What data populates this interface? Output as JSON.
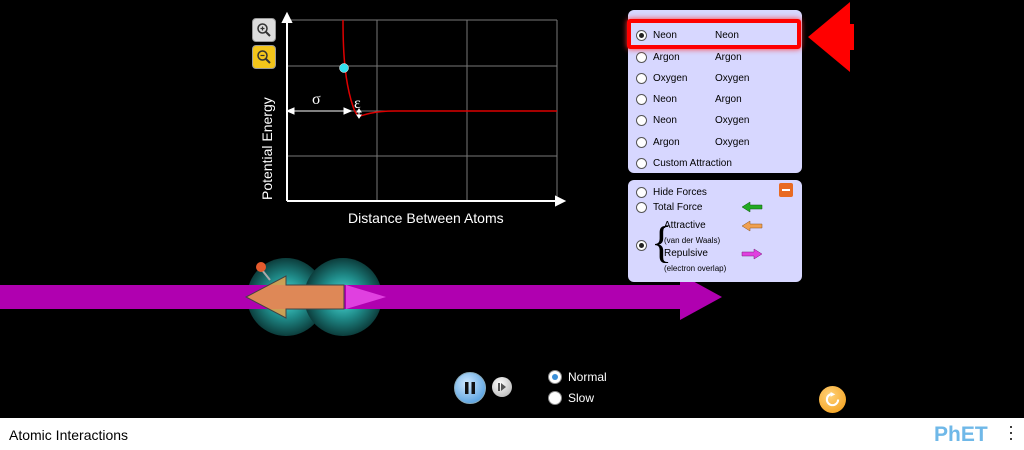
{
  "graph": {
    "y_axis_label": "Potential Energy",
    "x_axis_label": "Distance Between Atoms",
    "sigma_label": "σ",
    "epsilon_label": "ε"
  },
  "zoom": {
    "in_icon": "zoom-in-icon",
    "out_icon": "zoom-out-icon"
  },
  "atom_selector": {
    "options": [
      {
        "a": "Neon",
        "b": "Neon",
        "selected": true
      },
      {
        "a": "Argon",
        "b": "Argon"
      },
      {
        "a": "Oxygen",
        "b": "Oxygen"
      },
      {
        "a": "Neon",
        "b": "Argon"
      },
      {
        "a": "Neon",
        "b": "Oxygen"
      },
      {
        "a": "Argon",
        "b": "Oxygen"
      },
      {
        "a": "Custom Attraction",
        "b": ""
      }
    ]
  },
  "forces": {
    "hide_forces": "Hide Forces",
    "total_force": "Total Force",
    "attractive": "Attractive",
    "attractive_sub": "(van der Waals)",
    "repulsive": "Repulsive",
    "repulsive_sub": "(electron overlap)",
    "selected": "components",
    "colors": {
      "total": "#22aa22",
      "attractive": "#f0a050",
      "repulsive": "#e040e0"
    }
  },
  "playback": {
    "normal_label": "Normal",
    "slow_label": "Slow",
    "selected_speed": "Normal"
  },
  "footer": {
    "title": "Atomic Interactions",
    "logo": "PhET"
  },
  "highlight": {
    "color": "#ff0000"
  }
}
